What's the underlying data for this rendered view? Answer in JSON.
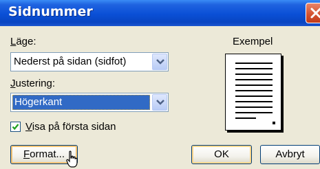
{
  "window": {
    "title": "Sidnummer"
  },
  "position": {
    "label_prefix": "L",
    "label_rest": "äge:",
    "selected_value": "Nederst på sidan (sidfot)"
  },
  "alignment": {
    "label_prefix": "J",
    "label_rest": "ustering:",
    "selected_value": "Högerkant"
  },
  "show_first_page": {
    "label_prefix": "V",
    "label_rest": "isa på första sidan",
    "checked": true
  },
  "preview": {
    "label": "Exempel"
  },
  "buttons": {
    "format_prefix": "F",
    "format_rest": "ormat...",
    "ok": "OK",
    "cancel": "Avbryt"
  },
  "colors": {
    "titlebar": "#0a4fd6",
    "selection": "#316ac5",
    "dialog_bg": "#ece9d8"
  }
}
